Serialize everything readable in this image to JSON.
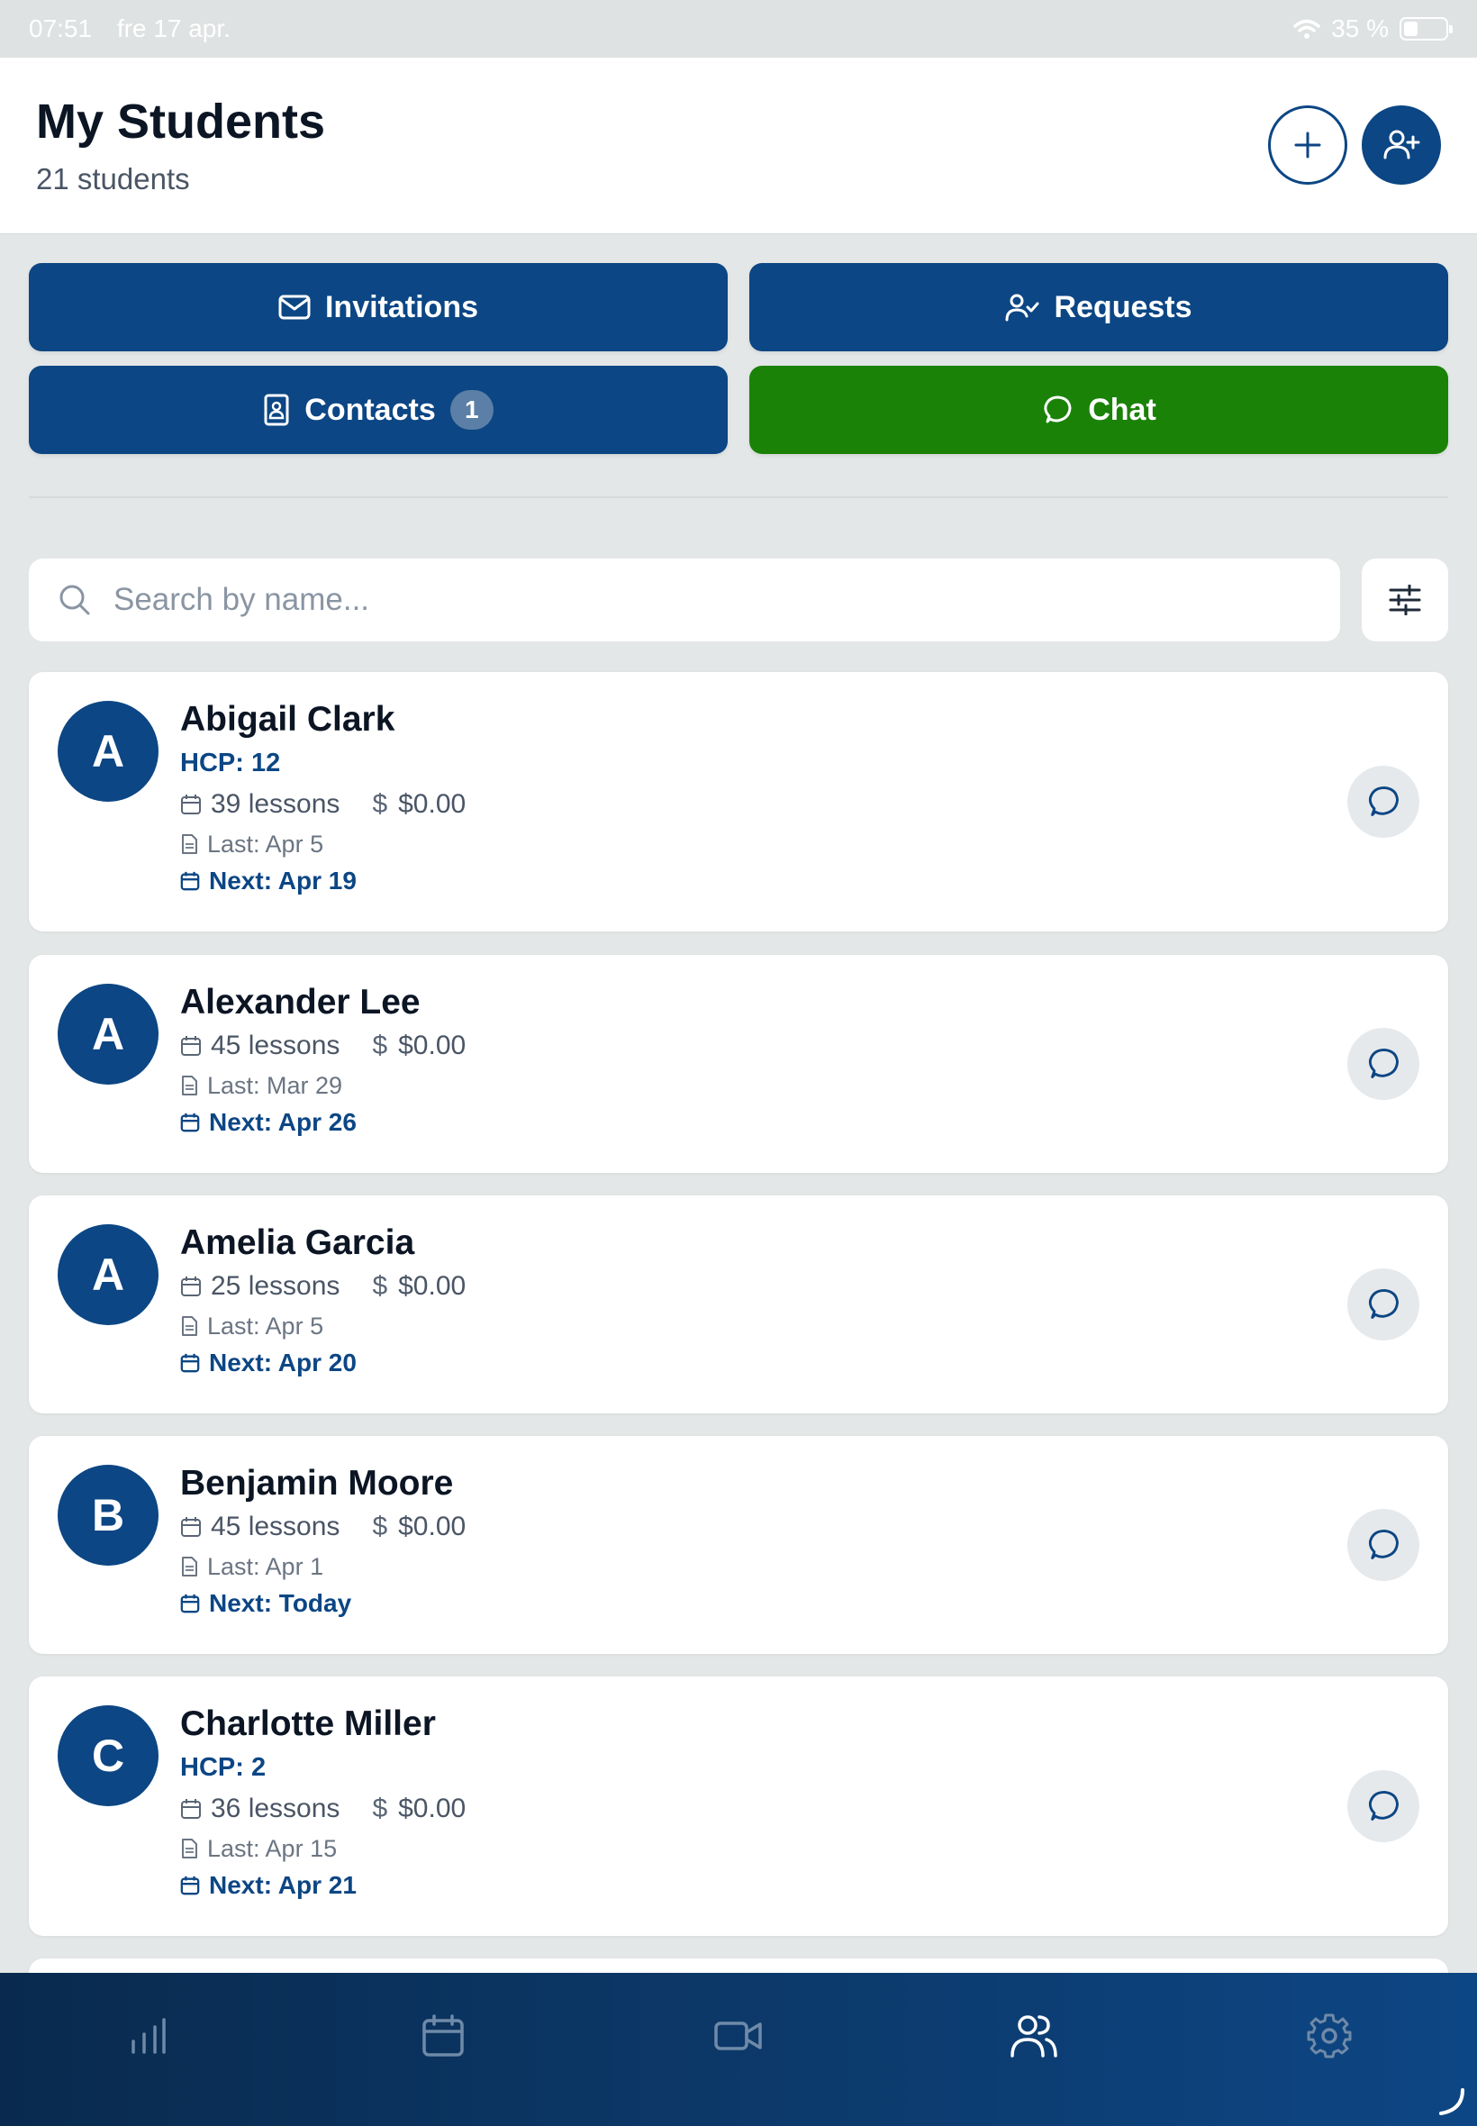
{
  "status_bar": {
    "time": "07:51",
    "date": "fre 17 apr.",
    "battery_text": "35 %",
    "battery_level": 0.35
  },
  "header": {
    "title": "My Students",
    "subtitle": "21 students"
  },
  "actions": {
    "invitations_label": "Invitations",
    "requests_label": "Requests",
    "contacts_label": "Contacts",
    "contacts_badge": "1",
    "chat_label": "Chat"
  },
  "search": {
    "placeholder": "Search by name...",
    "value": ""
  },
  "students": [
    {
      "initial": "A",
      "name": "Abigail Clark",
      "hcp": "HCP: 12",
      "lessons": "39 lessons",
      "balance": "$0.00",
      "last": "Last: Apr 5",
      "next": "Next: Apr 19"
    },
    {
      "initial": "A",
      "name": "Alexander Lee",
      "hcp": "",
      "lessons": "45 lessons",
      "balance": "$0.00",
      "last": "Last: Mar 29",
      "next": "Next: Apr 26"
    },
    {
      "initial": "A",
      "name": "Amelia Garcia",
      "hcp": "",
      "lessons": "25 lessons",
      "balance": "$0.00",
      "last": "Last: Apr 5",
      "next": "Next: Apr 20"
    },
    {
      "initial": "B",
      "name": "Benjamin Moore",
      "hcp": "",
      "lessons": "45 lessons",
      "balance": "$0.00",
      "last": "Last: Apr 1",
      "next": "Next: Today"
    },
    {
      "initial": "C",
      "name": "Charlotte Miller",
      "hcp": "HCP: 2",
      "lessons": "36 lessons",
      "balance": "$0.00",
      "last": "Last: Apr 15",
      "next": "Next: Apr 21"
    }
  ],
  "tabs": [
    {
      "icon": "bar-chart-icon",
      "active": false
    },
    {
      "icon": "calendar-icon",
      "active": false
    },
    {
      "icon": "video-icon",
      "active": false
    },
    {
      "icon": "users-icon",
      "active": true
    },
    {
      "icon": "gear-icon",
      "active": false
    }
  ],
  "colors": {
    "primary": "#0c4684",
    "chat_green": "#1b8208",
    "background": "#e4e7e7"
  }
}
